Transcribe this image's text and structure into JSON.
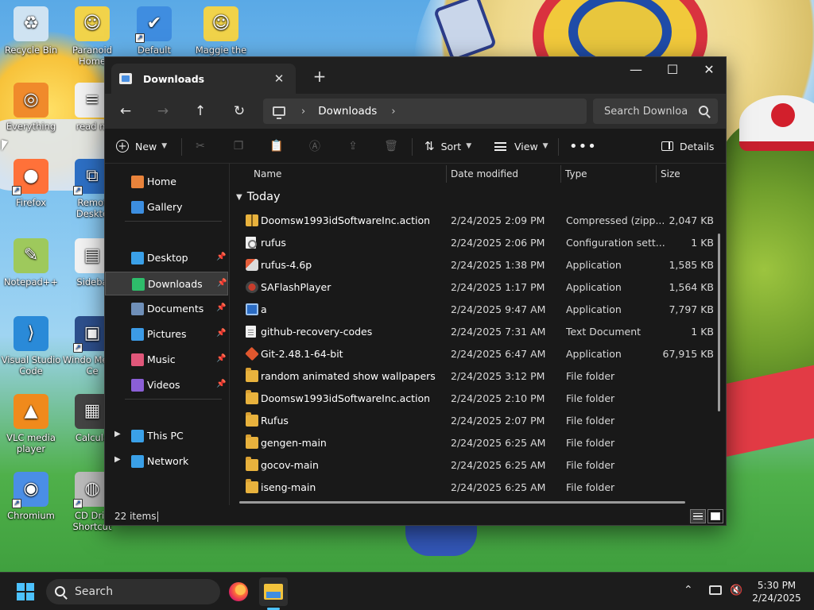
{
  "desktop": {
    "icons": [
      {
        "label": "Recycle Bin",
        "icon": "recycle-bin-icon"
      },
      {
        "label": "Paranoid Home",
        "icon": "paranoid-home-icon"
      },
      {
        "label": "Default",
        "icon": "default-programs-icon"
      },
      {
        "label": "Maggie the",
        "icon": "maggie-icon"
      },
      {
        "label": "Everything",
        "icon": "everything-search-icon"
      },
      {
        "label": "read m",
        "icon": "text-file-icon"
      },
      {
        "label": "Firefox",
        "icon": "firefox-icon"
      },
      {
        "label": "Remot Deskto",
        "icon": "remote-desktop-icon"
      },
      {
        "label": "Notepad++",
        "icon": "notepad-plus-plus-icon"
      },
      {
        "label": "Sideba",
        "icon": "sidebar-file-icon"
      },
      {
        "label": "Visual Studio Code",
        "icon": "vscode-icon"
      },
      {
        "label": "Windo Media Ce",
        "icon": "windows-media-center-icon"
      },
      {
        "label": "VLC media player",
        "icon": "vlc-icon"
      },
      {
        "label": "Calcula",
        "icon": "calculator-icon"
      },
      {
        "label": "Chromium",
        "icon": "chromium-icon"
      },
      {
        "label": "CD Driv Shortcut",
        "icon": "cd-drive-icon"
      }
    ]
  },
  "window": {
    "tab_title": "Downloads",
    "tab_close": "✕",
    "new_tab": "+",
    "minimize": "—",
    "maximize": "☐",
    "close": "✕"
  },
  "nav": {
    "back": "←",
    "forward": "→",
    "up": "↑",
    "refresh": "↻",
    "breadcrumb": [
      "Downloads"
    ],
    "search_placeholder": "Search Downloa"
  },
  "toolbar": {
    "new_label": "New",
    "sort_label": "Sort",
    "view_label": "View",
    "more_label": "•••",
    "details_label": "Details"
  },
  "sidebar": {
    "items": [
      {
        "label": "Home",
        "icon": "home-icon",
        "color": "#e9833b"
      },
      {
        "label": "Gallery",
        "icon": "gallery-icon",
        "color": "#3c8ee0"
      },
      {
        "label": "Desktop",
        "icon": "desktop-folder-icon",
        "color": "#3aa0e8",
        "pinned": true
      },
      {
        "label": "Downloads",
        "icon": "downloads-folder-icon",
        "color": "#2ebd6b",
        "pinned": true,
        "active": true
      },
      {
        "label": "Documents",
        "icon": "documents-folder-icon",
        "color": "#6f8fb8",
        "pinned": true
      },
      {
        "label": "Pictures",
        "icon": "pictures-folder-icon",
        "color": "#3c9be6",
        "pinned": true
      },
      {
        "label": "Music",
        "icon": "music-folder-icon",
        "color": "#e0577a",
        "pinned": true
      },
      {
        "label": "Videos",
        "icon": "videos-folder-icon",
        "color": "#8b5fd6",
        "pinned": true
      },
      {
        "label": "This PC",
        "icon": "this-pc-icon",
        "color": "#3aa0e8"
      },
      {
        "label": "Network",
        "icon": "network-icon",
        "color": "#3aa0e8"
      }
    ]
  },
  "columns": {
    "name": "Name",
    "date": "Date modified",
    "type": "Type",
    "size": "Size"
  },
  "group": {
    "label": "Today"
  },
  "files": [
    {
      "name": "Doomsw1993idSoftwareInc.action",
      "date": "2/24/2025 2:09 PM",
      "type": "Compressed (zipp...",
      "size": "2,047 KB",
      "icon": "zip-icon"
    },
    {
      "name": "rufus",
      "date": "2/24/2025 2:06 PM",
      "type": "Configuration sett...",
      "size": "1 KB",
      "icon": "config-file-icon"
    },
    {
      "name": "rufus-4.6p",
      "date": "2/24/2025 1:38 PM",
      "type": "Application",
      "size": "1,585 KB",
      "icon": "rufus-app-icon"
    },
    {
      "name": "SAFlashPlayer",
      "date": "2/24/2025 1:17 PM",
      "type": "Application",
      "size": "1,564 KB",
      "icon": "flash-player-icon"
    },
    {
      "name": "a",
      "date": "2/24/2025 9:47 AM",
      "type": "Application",
      "size": "7,797 KB",
      "icon": "application-icon"
    },
    {
      "name": "github-recovery-codes",
      "date": "2/24/2025 7:31 AM",
      "type": "Text Document",
      "size": "1 KB",
      "icon": "text-document-icon"
    },
    {
      "name": "Git-2.48.1-64-bit",
      "date": "2/24/2025 6:47 AM",
      "type": "Application",
      "size": "67,915 KB",
      "icon": "git-installer-icon"
    },
    {
      "name": "random animated show wallpapers",
      "date": "2/24/2025 3:12 PM",
      "type": "File folder",
      "size": "",
      "icon": "folder-icon"
    },
    {
      "name": "Doomsw1993idSoftwareInc.action",
      "date": "2/24/2025 2:10 PM",
      "type": "File folder",
      "size": "",
      "icon": "folder-icon"
    },
    {
      "name": "Rufus",
      "date": "2/24/2025 2:07 PM",
      "type": "File folder",
      "size": "",
      "icon": "folder-icon"
    },
    {
      "name": "gengen-main",
      "date": "2/24/2025 6:25 AM",
      "type": "File folder",
      "size": "",
      "icon": "folder-icon"
    },
    {
      "name": "gocov-main",
      "date": "2/24/2025 6:25 AM",
      "type": "File folder",
      "size": "",
      "icon": "folder-icon"
    },
    {
      "name": "iseng-main",
      "date": "2/24/2025 6:25 AM",
      "type": "File folder",
      "size": "",
      "icon": "folder-icon"
    }
  ],
  "status": {
    "item_count": "22 items"
  },
  "taskbar": {
    "search_label": "Search",
    "time": "5:30 PM",
    "date": "2/24/2025"
  }
}
